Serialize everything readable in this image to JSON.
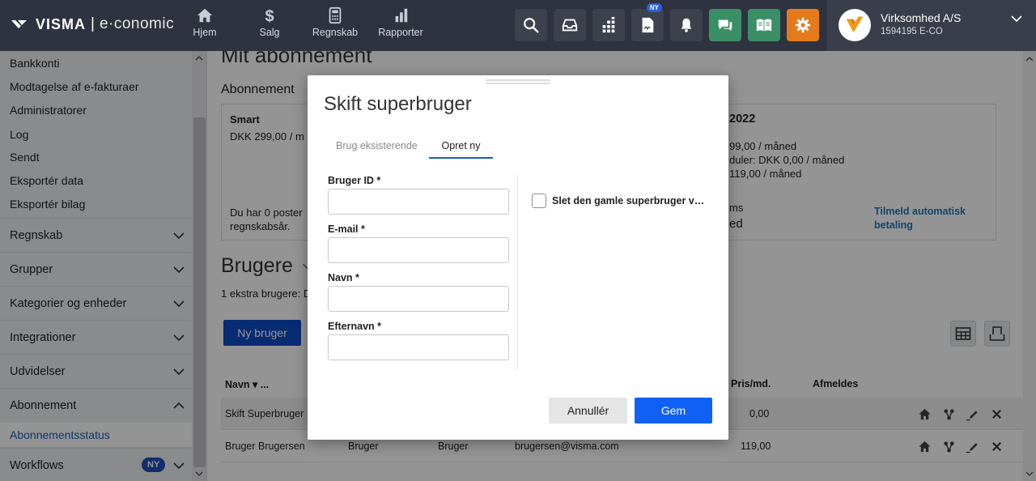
{
  "brand": {
    "name": "VISMA",
    "product": "e·conomic"
  },
  "nav": {
    "items": [
      {
        "label": "Hjem",
        "icon": "home-icon"
      },
      {
        "label": "Salg",
        "icon": "dollar-icon"
      },
      {
        "label": "Regnskab",
        "icon": "calculator-icon"
      },
      {
        "label": "Rapporter",
        "icon": "bar-chart-icon"
      }
    ],
    "badge": "NY"
  },
  "toolbar_icons": [
    "search-icon",
    "inbox-icon",
    "apps-icon",
    "document-icon",
    "bell-icon",
    "chat-icon",
    "book-icon",
    "settings-icon"
  ],
  "company": {
    "name": "Virksomhed A/S",
    "id": "1594195 E-CO"
  },
  "sidebar": {
    "links": [
      "Bankkonti",
      "Modtagelse af e-fakturaer",
      "Administratorer",
      "Log",
      "Sendt",
      "Eksportér data",
      "Eksportér bilag"
    ],
    "sections": [
      "Regnskab",
      "Grupper",
      "Kategorier og enheder",
      "Integrationer",
      "Udvidelser",
      "Abonnement"
    ],
    "active_item": "Abonnementsstatus",
    "last_section": "Workflows",
    "last_badge": "NY"
  },
  "main": {
    "page_title": "Mit abonnement",
    "subscription_title": "Abonnement",
    "plan_name": "Smart",
    "plan_price": "DKK 299,00 / m",
    "postings_line1": "Du har 0 poster",
    "postings_line2": "regnskabsår.",
    "year": "2022",
    "price_line1": "99,00 / måned",
    "price_line2": "duler: DKK 0,00 / måned",
    "price_line3": " 119,00 / måned",
    "status_label": "ms",
    "status_value": "ed",
    "autopay_line1": "Tilmeld automatisk",
    "autopay_line2": "betaling",
    "users_title": "Brugere",
    "users_sub": "1 ekstra brugere: D",
    "new_user_button": "Ny bruger",
    "table": {
      "headers": {
        "name": "Navn ▾ ...",
        "price": "Pris/md.",
        "cancel": "Afmeldes"
      },
      "rows": [
        {
          "name": "Skift Superbruger",
          "col2": "",
          "col3": "",
          "email": "",
          "price": "0,00"
        },
        {
          "name": "Bruger Brugersen",
          "col2": "Bruger",
          "col3": "Bruger",
          "email": "brugersen@visma.com",
          "price": "119,00"
        }
      ]
    }
  },
  "modal": {
    "title": "Skift superbruger",
    "tabs": {
      "existing": "Brug eksisterende",
      "new": "Opret ny"
    },
    "fields": {
      "user_id": {
        "label": "Bruger ID *",
        "value": ""
      },
      "email": {
        "label": "E-mail *",
        "value": ""
      },
      "first_name": {
        "label": "Navn *",
        "value": ""
      },
      "last_name": {
        "label": "Efternavn *",
        "value": ""
      }
    },
    "checkbox_label": "Slet den gamle superbruger v…",
    "cancel": "Annullér",
    "save": "Gem"
  },
  "colors": {
    "topbar": "#2f3340",
    "primary": "#1160f5",
    "link": "#1b7bb8",
    "active_nav": "#1b5dbe"
  }
}
